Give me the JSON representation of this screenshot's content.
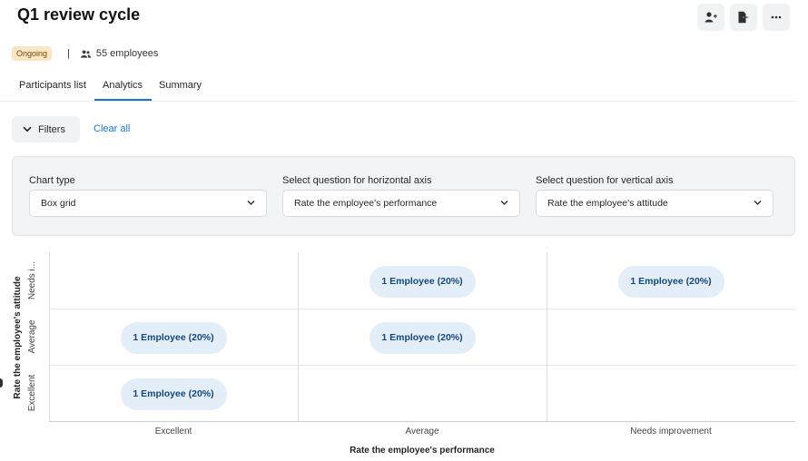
{
  "header": {
    "title": "Q1 review cycle",
    "actions": [
      "add-user-icon",
      "export-icon",
      "more-icon"
    ]
  },
  "meta": {
    "status": "Ongoing",
    "separator": "|",
    "employees": "55 employees"
  },
  "tabs": [
    {
      "label": "Participants list",
      "active": false
    },
    {
      "label": "Analytics",
      "active": true
    },
    {
      "label": "Summary",
      "active": false
    }
  ],
  "filters": {
    "button_label": "Filters",
    "clear_label": "Clear all"
  },
  "settings": {
    "chart_type_label": "Chart type",
    "chart_type_value": "Box grid",
    "horizontal_label": "Select question for horizontal axis",
    "horizontal_value": "Rate the employee's performance",
    "vertical_label": "Select question for vertical axis",
    "vertical_value": "Rate the employee's attitude"
  },
  "grid": {
    "x_categories": [
      "Excellent",
      "Average",
      "Needs improvement"
    ],
    "y_categories_top_to_bottom": [
      "Needs i...",
      "Average",
      "Excellent"
    ],
    "x_axis_label": "Rate the employee's performance",
    "y_axis_label": "Rate the employee's attitude",
    "cells": [
      {
        "x": "Average",
        "y": "Needs i...",
        "label": "1 Employee (20%)"
      },
      {
        "x": "Needs improvement",
        "y": "Needs i...",
        "label": "1 Employee (20%)"
      },
      {
        "x": "Excellent",
        "y": "Average",
        "label": "1 Employee (20%)"
      },
      {
        "x": "Average",
        "y": "Average",
        "label": "1 Employee (20%)"
      },
      {
        "x": "Excellent",
        "y": "Excellent",
        "label": "1 Employee (20%)"
      }
    ]
  },
  "colors": {
    "accent": "#1b74d1",
    "pill_bg": "#e4eef9",
    "pill_text": "#14487a",
    "badge_bg": "#fbe6c4"
  }
}
